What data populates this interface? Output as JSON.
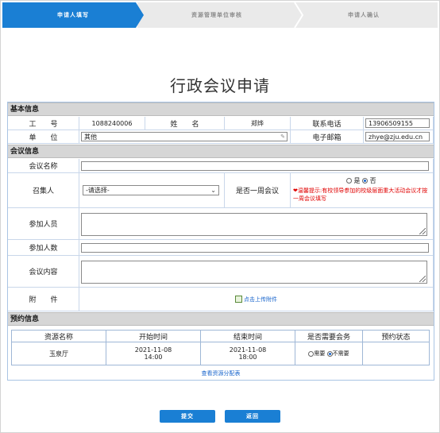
{
  "steps": [
    "申请人填写",
    "资源管理单位审核",
    "申请人确认"
  ],
  "title": "行政会议申请",
  "basic": {
    "section": "基本信息",
    "id_label": "工　　号",
    "id_value": "1088240006",
    "name_label": "姓　　名",
    "name_value": "郑烨",
    "phone_label": "联系电话",
    "phone_value": "13906509155",
    "unit_label": "单　　位",
    "unit_value": "其他",
    "email_label": "电子邮箱",
    "email_value": "zhye@zju.edu.cn"
  },
  "meeting": {
    "section": "会议信息",
    "name_label": "会议名称",
    "name_value": "",
    "convener_label": "召集人",
    "convener_value": "-请选择-",
    "weekly_label": "是否一周会议",
    "yes": "是",
    "no": "否",
    "weekly_selected": "否",
    "warning": "温馨提示:有校领导参加的校级层面重大活动会议才按一周会议填写",
    "attendees_label": "参加人员",
    "count_label": "参加人数",
    "content_label": "会议内容",
    "attach_label": "附　　件",
    "attach_link": "点击上传附件"
  },
  "booking": {
    "section": "预约信息",
    "headers": [
      "资源名称",
      "开始时间",
      "结束时间",
      "是否需要会务",
      "预约状态"
    ],
    "rows": [
      {
        "resource": "玉泉厅",
        "start_date": "2021-11-08",
        "start_time": "14:00",
        "end_date": "2021-11-08",
        "end_time": "18:00",
        "need": "需要",
        "no_need": "不需要",
        "service_selected": "不需要",
        "status": ""
      }
    ],
    "view_link": "查看资源分配表"
  },
  "buttons": {
    "submit": "提交",
    "back": "返回"
  },
  "colors": {
    "accent": "#1a7fd4",
    "section_bg": "#d6d6d6",
    "warning": "#e00000"
  }
}
